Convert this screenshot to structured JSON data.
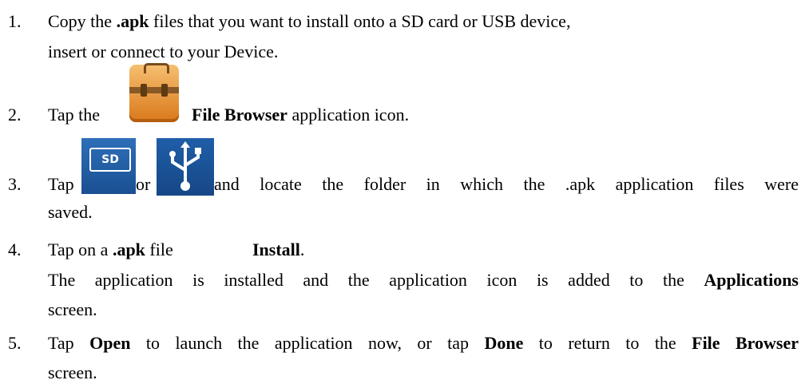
{
  "steps": [
    {
      "number": "1.",
      "line1": {
        "pre": "Copy the ",
        "bold": ".apk",
        "post": " files that you want to install onto a SD card or USB device,"
      },
      "line2": "insert or connect to your Device."
    },
    {
      "number": "2.",
      "pre": "Tap the",
      "bold": "File Browser",
      "post": " application icon."
    },
    {
      "number": "3.",
      "pre": "Tap",
      "mid": "or",
      "post": "and locate the folder in which the .apk application files were",
      "line2": "saved."
    },
    {
      "number": "4.",
      "pre": "Tap on a ",
      "bold": ".apk",
      "post": " file",
      "bold2": "Install",
      "post2": ".",
      "line2": {
        "pre": "The application is installed and the application icon is added to the ",
        "bold": "Applications"
      },
      "line3": "screen."
    },
    {
      "number": "5.",
      "pre": "Tap ",
      "bold": "Open",
      "mid": " to launch the application now, or tap ",
      "bold2": "Done",
      "post": " to return to the ",
      "bold3": "File Browser",
      "line2": "screen."
    }
  ],
  "icons": {
    "file_browser": "file-browser-icon",
    "sd_card": "sd-card-icon",
    "sd_label": "SD",
    "usb": "usb-icon"
  }
}
